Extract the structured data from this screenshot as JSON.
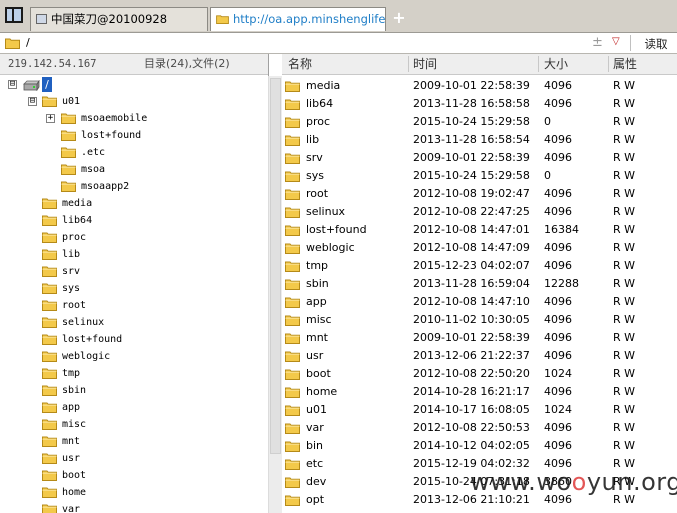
{
  "tabs": [
    {
      "label": "中国菜刀@20100928",
      "active": false
    },
    {
      "label": "http://oa.app.minshenglife.co...",
      "active": true
    }
  ],
  "new_tab_label": "+",
  "address": {
    "path": "/",
    "plus_glyph": "±",
    "dropdown_glyph": "▽",
    "read_button": "读取"
  },
  "left_panel": {
    "ip": "219.142.54.167",
    "summary": "目录(24),文件(2)",
    "root_label": "/",
    "tree_u01": {
      "label": "u01",
      "expander": "⊟"
    },
    "tree_root_expander": "⊟",
    "u01_children": [
      {
        "label": "msoaemobile",
        "expander": "+"
      },
      {
        "label": "lost+found"
      },
      {
        "label": ".etc"
      },
      {
        "label": "msoa"
      },
      {
        "label": "msoaapp2"
      }
    ],
    "root_children": [
      "media",
      "lib64",
      "proc",
      "lib",
      "srv",
      "sys",
      "root",
      "selinux",
      "lost+found",
      "weblogic",
      "tmp",
      "sbin",
      "app",
      "misc",
      "mnt",
      "usr",
      "boot",
      "home",
      "var"
    ]
  },
  "file_list": {
    "columns": [
      "名称",
      "时间",
      "大小",
      "属性"
    ],
    "rows": [
      {
        "name": "media",
        "time": "2009-10-01 22:58:39",
        "size": "4096",
        "attr": "R W"
      },
      {
        "name": "lib64",
        "time": "2013-11-28 16:58:58",
        "size": "4096",
        "attr": "R W"
      },
      {
        "name": "proc",
        "time": "2015-10-24 15:29:58",
        "size": "0",
        "attr": "R W"
      },
      {
        "name": "lib",
        "time": "2013-11-28 16:58:54",
        "size": "4096",
        "attr": "R W"
      },
      {
        "name": "srv",
        "time": "2009-10-01 22:58:39",
        "size": "4096",
        "attr": "R W"
      },
      {
        "name": "sys",
        "time": "2015-10-24 15:29:58",
        "size": "0",
        "attr": "R W"
      },
      {
        "name": "root",
        "time": "2012-10-08 19:02:47",
        "size": "4096",
        "attr": "R W"
      },
      {
        "name": "selinux",
        "time": "2012-10-08 22:47:25",
        "size": "4096",
        "attr": "R W"
      },
      {
        "name": "lost+found",
        "time": "2012-10-08 14:47:01",
        "size": "16384",
        "attr": "R W"
      },
      {
        "name": "weblogic",
        "time": "2012-10-08 14:47:09",
        "size": "4096",
        "attr": "R W"
      },
      {
        "name": "tmp",
        "time": "2015-12-23 04:02:07",
        "size": "4096",
        "attr": "R W"
      },
      {
        "name": "sbin",
        "time": "2013-11-28 16:59:04",
        "size": "12288",
        "attr": "R W"
      },
      {
        "name": "app",
        "time": "2012-10-08 14:47:10",
        "size": "4096",
        "attr": "R W"
      },
      {
        "name": "misc",
        "time": "2010-11-02 10:30:05",
        "size": "4096",
        "attr": "R W"
      },
      {
        "name": "mnt",
        "time": "2009-10-01 22:58:39",
        "size": "4096",
        "attr": "R W"
      },
      {
        "name": "usr",
        "time": "2013-12-06 21:22:37",
        "size": "4096",
        "attr": "R W"
      },
      {
        "name": "boot",
        "time": "2012-10-08 22:50:20",
        "size": "1024",
        "attr": "R W"
      },
      {
        "name": "home",
        "time": "2014-10-28 16:21:17",
        "size": "4096",
        "attr": "R W"
      },
      {
        "name": "u01",
        "time": "2014-10-17 16:08:05",
        "size": "1024",
        "attr": "R W"
      },
      {
        "name": "var",
        "time": "2012-10-08 22:50:53",
        "size": "4096",
        "attr": "R W"
      },
      {
        "name": "bin",
        "time": "2014-10-12 04:02:05",
        "size": "4096",
        "attr": "R W"
      },
      {
        "name": "etc",
        "time": "2015-12-19 04:02:32",
        "size": "4096",
        "attr": "R W"
      },
      {
        "name": "dev",
        "time": "2015-10-24 07:31:18",
        "size": "3860",
        "attr": "R W"
      },
      {
        "name": "opt",
        "time": "2013-12-06 21:10:21",
        "size": "4096",
        "attr": "R W"
      }
    ]
  },
  "watermark": {
    "prefix": "www.wo",
    "o": "o",
    "suffix": "yun.org"
  },
  "colors": {
    "tab_link": "#1f7ec7",
    "folder": "#f3c94a",
    "selection": "#2060c0"
  },
  "icons": {
    "folder": "folder-icon",
    "drive": "hard-drive-icon",
    "app": "app-window-icon"
  }
}
